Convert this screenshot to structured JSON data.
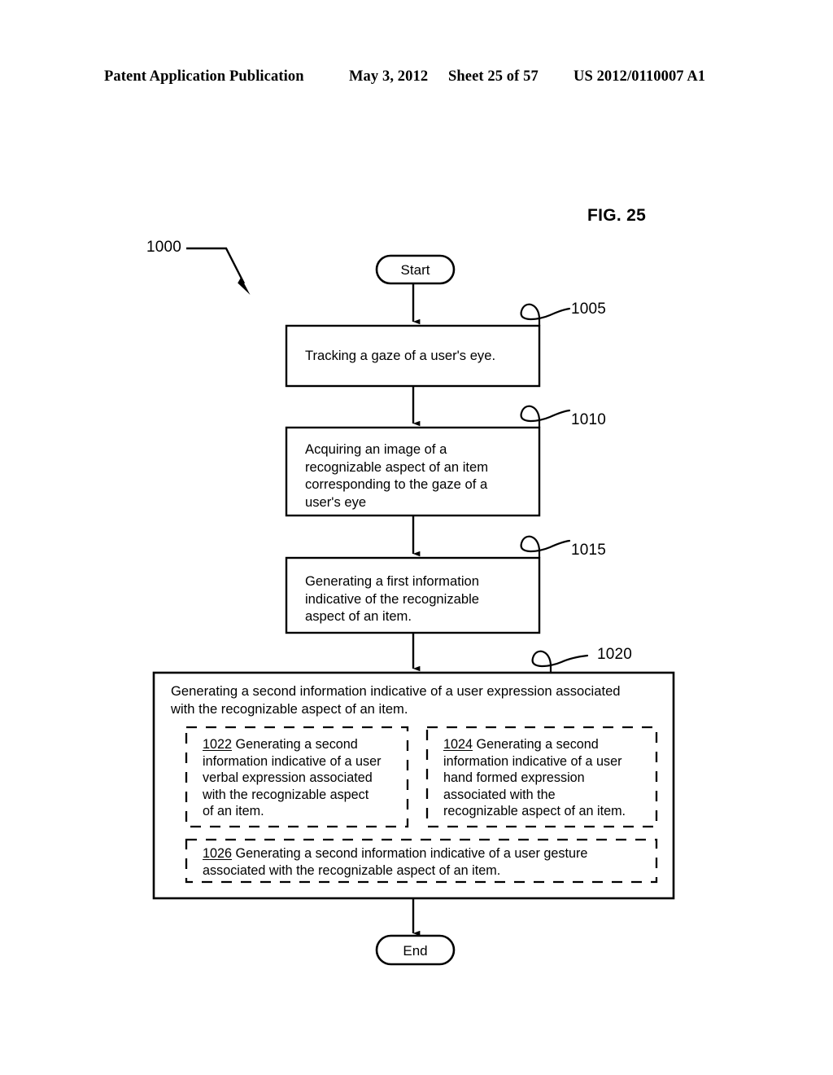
{
  "header": {
    "publication": "Patent Application Publication",
    "date": "May 3, 2012",
    "sheet": "Sheet 25 of 57",
    "patent_number": "US 2012/0110007 A1"
  },
  "figure": {
    "label": "FIG. 25",
    "diagram_ref": "1000"
  },
  "flowchart": {
    "start_label": "Start",
    "end_label": "End",
    "steps": [
      {
        "ref": "1005",
        "text": "Tracking a gaze of a user's eye."
      },
      {
        "ref": "1010",
        "text": "Acquiring an image of a\nrecognizable aspect of an item\ncorresponding to the gaze of a\nuser's eye"
      },
      {
        "ref": "1015",
        "text": "Generating a first information\nindicative of the recognizable\naspect of an item."
      }
    ],
    "composite_step": {
      "ref": "1020",
      "text": "Generating a second information indicative of a user expression associated\nwith the recognizable aspect of an item.",
      "sub_steps": [
        {
          "ref": "1022",
          "text": "Generating a second\ninformation indicative of a user\nverbal expression associated\nwith the recognizable aspect\nof an item."
        },
        {
          "ref": "1024",
          "text": "Generating a second\ninformation indicative of a user\nhand formed expression\nassociated with the\nrecognizable aspect of an item."
        },
        {
          "ref": "1026",
          "text": "Generating a second information indicative of a user gesture\nassociated with the recognizable aspect of an item."
        }
      ]
    }
  }
}
